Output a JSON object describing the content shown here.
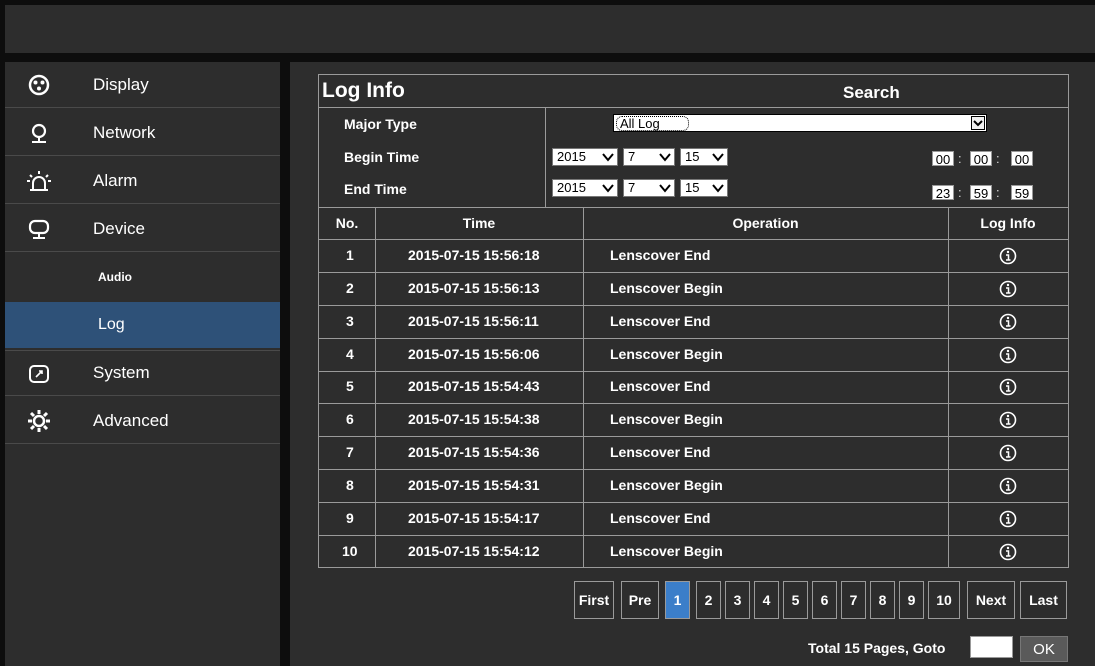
{
  "sidebar": {
    "items": [
      {
        "label": "Display",
        "icon": "display-icon"
      },
      {
        "label": "Network",
        "icon": "network-icon"
      },
      {
        "label": "Alarm",
        "icon": "alarm-icon"
      },
      {
        "label": "Device",
        "icon": "device-icon"
      },
      {
        "label": "Audio"
      },
      {
        "label": "Log",
        "active": true
      },
      {
        "label": "System",
        "icon": "system-icon"
      },
      {
        "label": "Advanced",
        "icon": "advanced-icon"
      }
    ]
  },
  "panel": {
    "title": "Log Info",
    "search_title": "Search",
    "major_type_label": "Major Type",
    "major_type_value": "All Log",
    "begin_label": "Begin Time",
    "end_label": "End Time",
    "begin": {
      "year": "2015",
      "month": "7",
      "day": "15",
      "hh": "00",
      "mm": "00",
      "ss": "00"
    },
    "end": {
      "year": "2015",
      "month": "7",
      "day": "15",
      "hh": "23",
      "mm": "59",
      "ss": "59"
    }
  },
  "table": {
    "headers": [
      "No.",
      "Time",
      "Operation",
      "Log Info"
    ],
    "rows": [
      {
        "no": "1",
        "time": "2015-07-15 15:56:18",
        "op": "Lenscover End"
      },
      {
        "no": "2",
        "time": "2015-07-15 15:56:13",
        "op": "Lenscover Begin"
      },
      {
        "no": "3",
        "time": "2015-07-15 15:56:11",
        "op": "Lenscover End"
      },
      {
        "no": "4",
        "time": "2015-07-15 15:56:06",
        "op": "Lenscover Begin"
      },
      {
        "no": "5",
        "time": "2015-07-15 15:54:43",
        "op": "Lenscover End"
      },
      {
        "no": "6",
        "time": "2015-07-15 15:54:38",
        "op": "Lenscover Begin"
      },
      {
        "no": "7",
        "time": "2015-07-15 15:54:36",
        "op": "Lenscover End"
      },
      {
        "no": "8",
        "time": "2015-07-15 15:54:31",
        "op": "Lenscover Begin"
      },
      {
        "no": "9",
        "time": "2015-07-15 15:54:17",
        "op": "Lenscover End"
      },
      {
        "no": "10",
        "time": "2015-07-15 15:54:12",
        "op": "Lenscover Begin"
      }
    ]
  },
  "pager": {
    "first": "First",
    "pre": "Pre",
    "next": "Next",
    "last": "Last",
    "pages": [
      "1",
      "2",
      "3",
      "4",
      "5",
      "6",
      "7",
      "8",
      "9",
      "10"
    ],
    "current": "1",
    "total_text": "Total 15 Pages, Goto",
    "ok": "OK"
  },
  "colors": {
    "accent": "#3b7ec9",
    "active_nav": "#2e5178",
    "panel_bg": "#2d2d2d"
  }
}
